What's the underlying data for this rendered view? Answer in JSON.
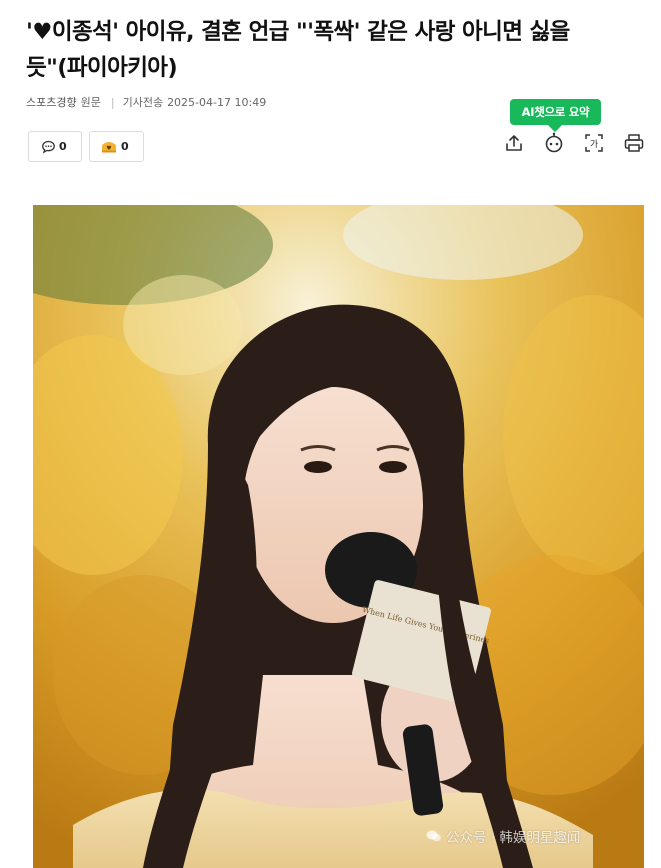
{
  "article": {
    "headline_line1": "'♥이종석' 아이유, 결혼 언급 \"'폭싹' 같은 사랑 아니면 싫을",
    "headline_line2": "듯\"(파이아키아)",
    "source": "스포츠경향",
    "source_suffix": "원문",
    "date_label": "기사전송",
    "datetime": "2025-04-17 10:49"
  },
  "counters": {
    "comments": "0",
    "reactions": "0"
  },
  "toolbar": {
    "ai_summary_label": "AI챗으로 요약",
    "icons": [
      "share-icon",
      "ai-bot-icon",
      "text-size-icon",
      "print-icon"
    ],
    "accent": "#19b95b"
  },
  "photo": {
    "mic_flag_text": "When Life Gives You Tangerines"
  },
  "watermark": {
    "text": "公众号 · 韩娱明星趣闻"
  }
}
